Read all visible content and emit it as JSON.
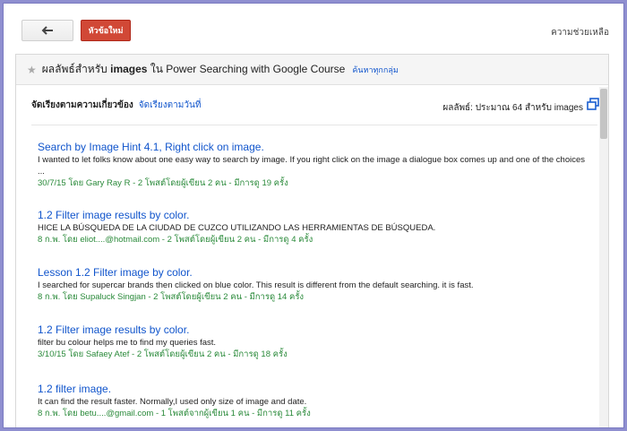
{
  "toolbar": {
    "back_icon": "arrow-left-icon",
    "new_topic_label": "หัวข้อใหม่",
    "help_label": "ความช่วยเหลือ",
    "new_topic_color": "#d14836"
  },
  "search_header": {
    "star_icon": "star-icon",
    "prefix": "ผลลัพธ์สำหรับ",
    "term": "images",
    "in_word": "ใน",
    "course": "Power Searching with Google Course",
    "search_all_label": "ค้นหาทุกกลุ่ม"
  },
  "sort": {
    "relevance_label": "จัดเรียงตามความเกี่ยวข้อง",
    "date_label": "จัดเรียงตามวันที่",
    "result_count": "ผลลัพธ์: ประมาณ 64 สำหรับ images",
    "copy_icon": "open-in-new-window-icon"
  },
  "results": [
    {
      "title": "Search by Image Hint 4.1, Right click on image.",
      "snippet": "I wanted to let folks know about one easy way to search by image. If you right click on the image a dialogue box comes up and one of the choices ...",
      "meta": "30/7/15 โดย Gary Ray R - 2 โพสต์โดยผู้เขียน 2 คน - มีการดู 19 ครั้ง"
    },
    {
      "title": "1.2 Filter image results by color.",
      "snippet": "HICE LA BÚSQUEDA DE LA CIUDAD DE CUZCO UTILIZANDO LAS HERRAMIENTAS DE BÚSQUEDA.",
      "meta": "8 ก.พ. โดย eliot....@hotmail.com - 2 โพสต์โดยผู้เขียน 2 คน - มีการดู 4 ครั้ง"
    },
    {
      "title": "Lesson 1.2 Filter image by color.",
      "snippet": "I searched for supercar brands then clicked on blue color. This result is different from the default searching. it is fast.",
      "meta": "8 ก.พ. โดย Supaluck Singjan - 2 โพสต์โดยผู้เขียน 2 คน - มีการดู 14 ครั้ง"
    },
    {
      "title": "1.2 Filter image results by color.",
      "snippet": "filter bu colour helps me to find my queries fast.",
      "meta": "3/10/15 โดย Safaey Atef - 2 โพสต์โดยผู้เขียน 2 คน - มีการดู 18 ครั้ง"
    },
    {
      "title": "1.2 filter image.",
      "snippet": "It can find the result faster. Normally,I used only size of image and date.",
      "meta": "8 ก.พ. โดย betu....@gmail.com - 1 โพสต์จากผู้เขียน 1 คน - มีการดู 11 ครั้ง"
    }
  ]
}
